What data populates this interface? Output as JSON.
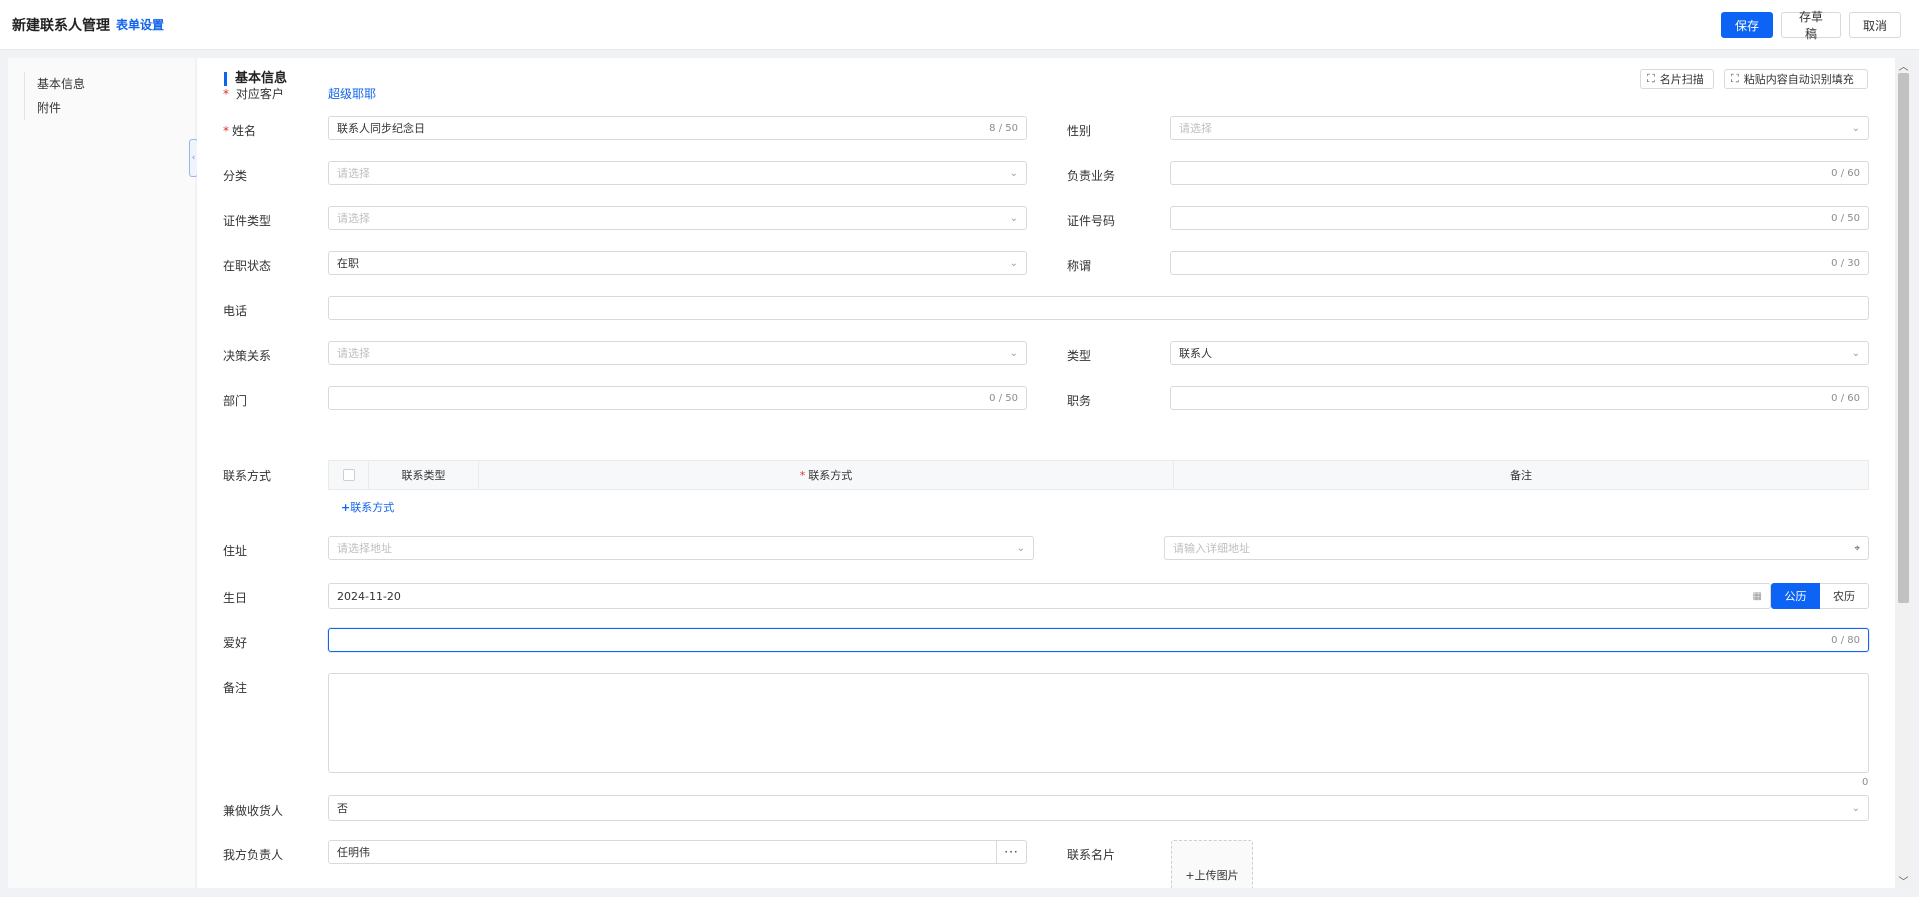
{
  "header": {
    "title": "新建联系人管理",
    "form_settings": "表单设置",
    "save": "保存",
    "draft": "存草稿",
    "cancel": "取消"
  },
  "sidebar": {
    "items": [
      {
        "label": "基本信息"
      },
      {
        "label": "附件"
      }
    ]
  },
  "section": {
    "title": "基本信息",
    "card_scan": "名片扫描",
    "paste_fill": "粘贴内容自动识别填充"
  },
  "form": {
    "customer_label": "对应客户",
    "customer_value": "超级耶耶",
    "name_label": "姓名",
    "name_value": "联系人同步纪念日",
    "name_count": "8 / 50",
    "gender_label": "性别",
    "gender_placeholder": "请选择",
    "category_label": "分类",
    "category_placeholder": "请选择",
    "business_label": "负责业务",
    "business_count": "0 / 60",
    "id_type_label": "证件类型",
    "id_type_placeholder": "请选择",
    "id_number_label": "证件号码",
    "id_number_count": "0 / 50",
    "status_label": "在职状态",
    "status_value": "在职",
    "salutation_label": "称谓",
    "salutation_count": "0 / 30",
    "phone_label": "电话",
    "decision_label": "决策关系",
    "decision_placeholder": "请选择",
    "type_label": "类型",
    "type_value": "联系人",
    "dept_label": "部门",
    "dept_count": "0 / 50",
    "position_label": "职务",
    "position_count": "0 / 60",
    "contact_label": "联系方式",
    "contact_table": {
      "col_type": "联系类型",
      "col_method": "联系方式",
      "col_note": "备注"
    },
    "add_contact": "联系方式",
    "address_label": "住址",
    "address_placeholder": "请选择地址",
    "address_detail_placeholder": "请输入详细地址",
    "birthday_label": "生日",
    "birthday_value": "2024-11-20",
    "calendar_solar": "公历",
    "calendar_lunar": "农历",
    "hobby_label": "爱好",
    "hobby_count": "0 / 80",
    "remark_label": "备注",
    "remark_count": "0",
    "receiver_label": "兼做收货人",
    "receiver_value": "否",
    "owner_label": "我方负责人",
    "owner_value": "任明伟",
    "card_label": "联系名片",
    "upload_label": "上传图片"
  }
}
